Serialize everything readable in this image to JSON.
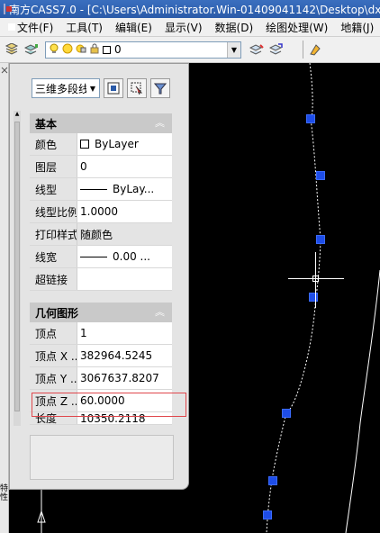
{
  "window": {
    "title": "南方CASS7.0 - [C:\\Users\\Administrator.Win-01409041142\\Desktop\\dx"
  },
  "menu": {
    "items": [
      "文件(F)",
      "工具(T)",
      "编辑(E)",
      "显示(V)",
      "数据(D)",
      "绘图处理(W)",
      "地籍(J)"
    ]
  },
  "toolbar": {
    "layer_value": "0"
  },
  "palette": {
    "object_type": "三维多段线",
    "edge_label": "特性",
    "sections": {
      "basic": {
        "title": "基本",
        "rows": [
          {
            "name": "颜色",
            "value": "ByLayer"
          },
          {
            "name": "图层",
            "value": "0"
          },
          {
            "name": "线型",
            "value": "ByLay..."
          },
          {
            "name": "线型比例",
            "value": "1.0000"
          },
          {
            "name": "打印样式",
            "value": "随颜色"
          },
          {
            "name": "线宽",
            "value": "0.00 ..."
          },
          {
            "name": "超链接",
            "value": ""
          }
        ]
      },
      "geometry": {
        "title": "几何图形",
        "rows": [
          {
            "name": "顶点",
            "value": "1"
          },
          {
            "name": "顶点 X ...",
            "value": "382964.5245"
          },
          {
            "name": "顶点 Y ...",
            "value": "3067637.8207"
          },
          {
            "name": "顶点 Z ...",
            "value": "60.0000"
          },
          {
            "name": "长度",
            "value": "10350.2118"
          }
        ]
      }
    }
  },
  "colors": {
    "canvas_bg": "#000000",
    "grip": "#1e4de8",
    "highlight_box": "#e0474c"
  }
}
